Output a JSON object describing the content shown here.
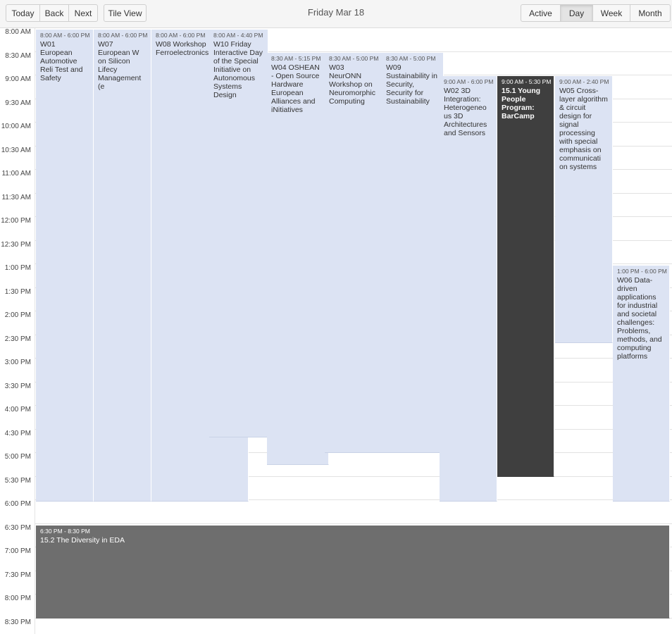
{
  "toolbar": {
    "today": "Today",
    "back": "Back",
    "next": "Next",
    "tile_view": "Tile View",
    "title": "Friday Mar 18",
    "views": {
      "active": "Active",
      "day": "Day",
      "week": "Week",
      "month": "Month"
    },
    "selected_view": "Day"
  },
  "colors": {
    "event_default": "#dce3f3",
    "event_selected": "#3f3f3f",
    "event_evening": "#6e6e6e"
  },
  "time_labels": [
    "8:00 AM",
    "8:30 AM",
    "9:00 AM",
    "9:30 AM",
    "10:00 AM",
    "10:30 AM",
    "11:00 AM",
    "11:30 AM",
    "12:00 PM",
    "12:30 PM",
    "1:00 PM",
    "1:30 PM",
    "2:00 PM",
    "2:30 PM",
    "3:00 PM",
    "3:30 PM",
    "4:00 PM",
    "4:30 PM",
    "5:00 PM",
    "5:30 PM",
    "6:00 PM",
    "6:30 PM",
    "7:00 PM",
    "7:30 PM",
    "8:00 PM",
    "8:30 PM"
  ],
  "events": [
    {
      "id": "w01",
      "time": "8:00 AM - 6:00 PM",
      "title": "W01 European Automotive Reli Test and Safety"
    },
    {
      "id": "w07",
      "time": "8:00 AM - 6:00 PM",
      "title": "W07 European W on Silicon Lifecy Management (e"
    },
    {
      "id": "w08",
      "time": "8:00 AM - 6:00 PM",
      "title": "W08 Workshop Ferroelectronics"
    },
    {
      "id": "w10",
      "time": "8:00 AM - 4:40 PM",
      "title": "W10 Friday Interactive Day of the Special Initiative on Autonomous Systems Design"
    },
    {
      "id": "w04",
      "time": "8:30 AM - 5:15 PM",
      "title": "W04 OSHEAN - Open Source Hardware European Alliances and iNitiatives"
    },
    {
      "id": "w03",
      "time": "8:30 AM - 5:00 PM",
      "title": "W03 NeurONN Workshop on Neuromorphic Computing"
    },
    {
      "id": "w09",
      "time": "8:30 AM - 5:00 PM",
      "title": "W09 Sustainability in Security, Security for Sustainability"
    },
    {
      "id": "w02",
      "time": "9:00 AM - 6:00 PM",
      "title": "W02 3D Integration: Heterogeneo us 3D Architectures and Sensors"
    },
    {
      "id": "yp",
      "time": "9:00 AM - 5:30 PM",
      "title": "15.1 Young People Program: BarCamp"
    },
    {
      "id": "w05",
      "time": "9:00 AM - 2:40 PM",
      "title": "W05 Cross-layer algorithm & circuit design for signal processing with special emphasis on communicati on systems"
    },
    {
      "id": "w06",
      "time": "1:00 PM - 6:00 PM",
      "title": "W06 Data-driven applications for industrial and societal challenges: Problems, methods, and computing platforms"
    },
    {
      "id": "div",
      "time": "6:30 PM - 8:30 PM",
      "title": "15.2 The Diversity in EDA"
    }
  ]
}
